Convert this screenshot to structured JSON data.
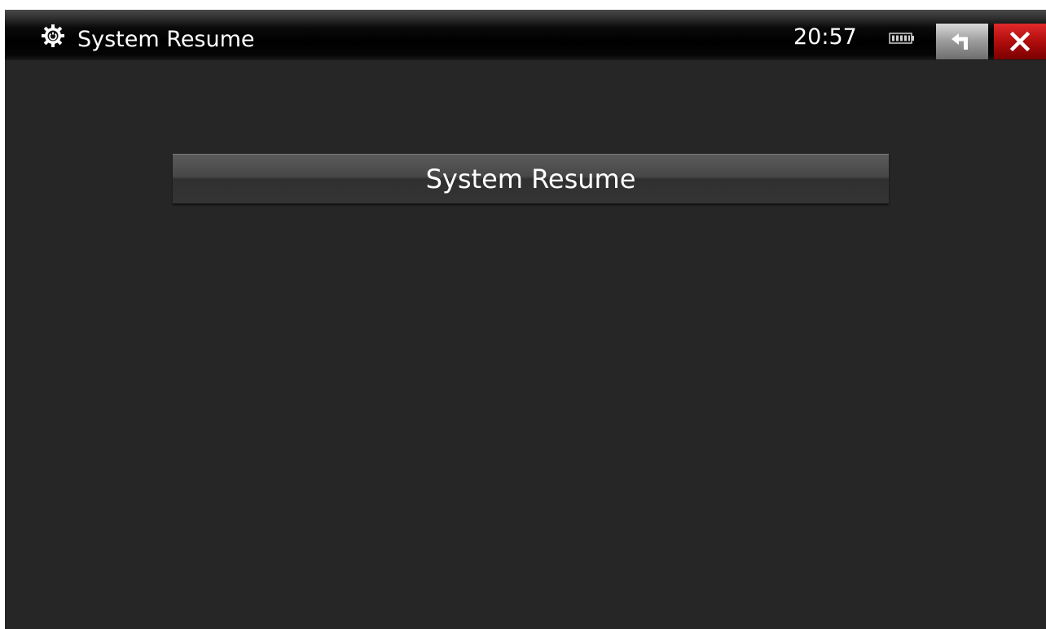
{
  "titlebar": {
    "title": "System Resume",
    "icon": "settings-gear-icon",
    "clock": "20:57",
    "battery_icon": "battery-icon",
    "back_icon": "back-arrow-icon",
    "close_icon": "close-icon"
  },
  "main": {
    "resume_button_label": "System Resume"
  },
  "colors": {
    "background": "#262626",
    "titlebar": "#000000",
    "close_button": "#c41010",
    "back_button": "#a0a0a0",
    "text": "#ffffff"
  }
}
